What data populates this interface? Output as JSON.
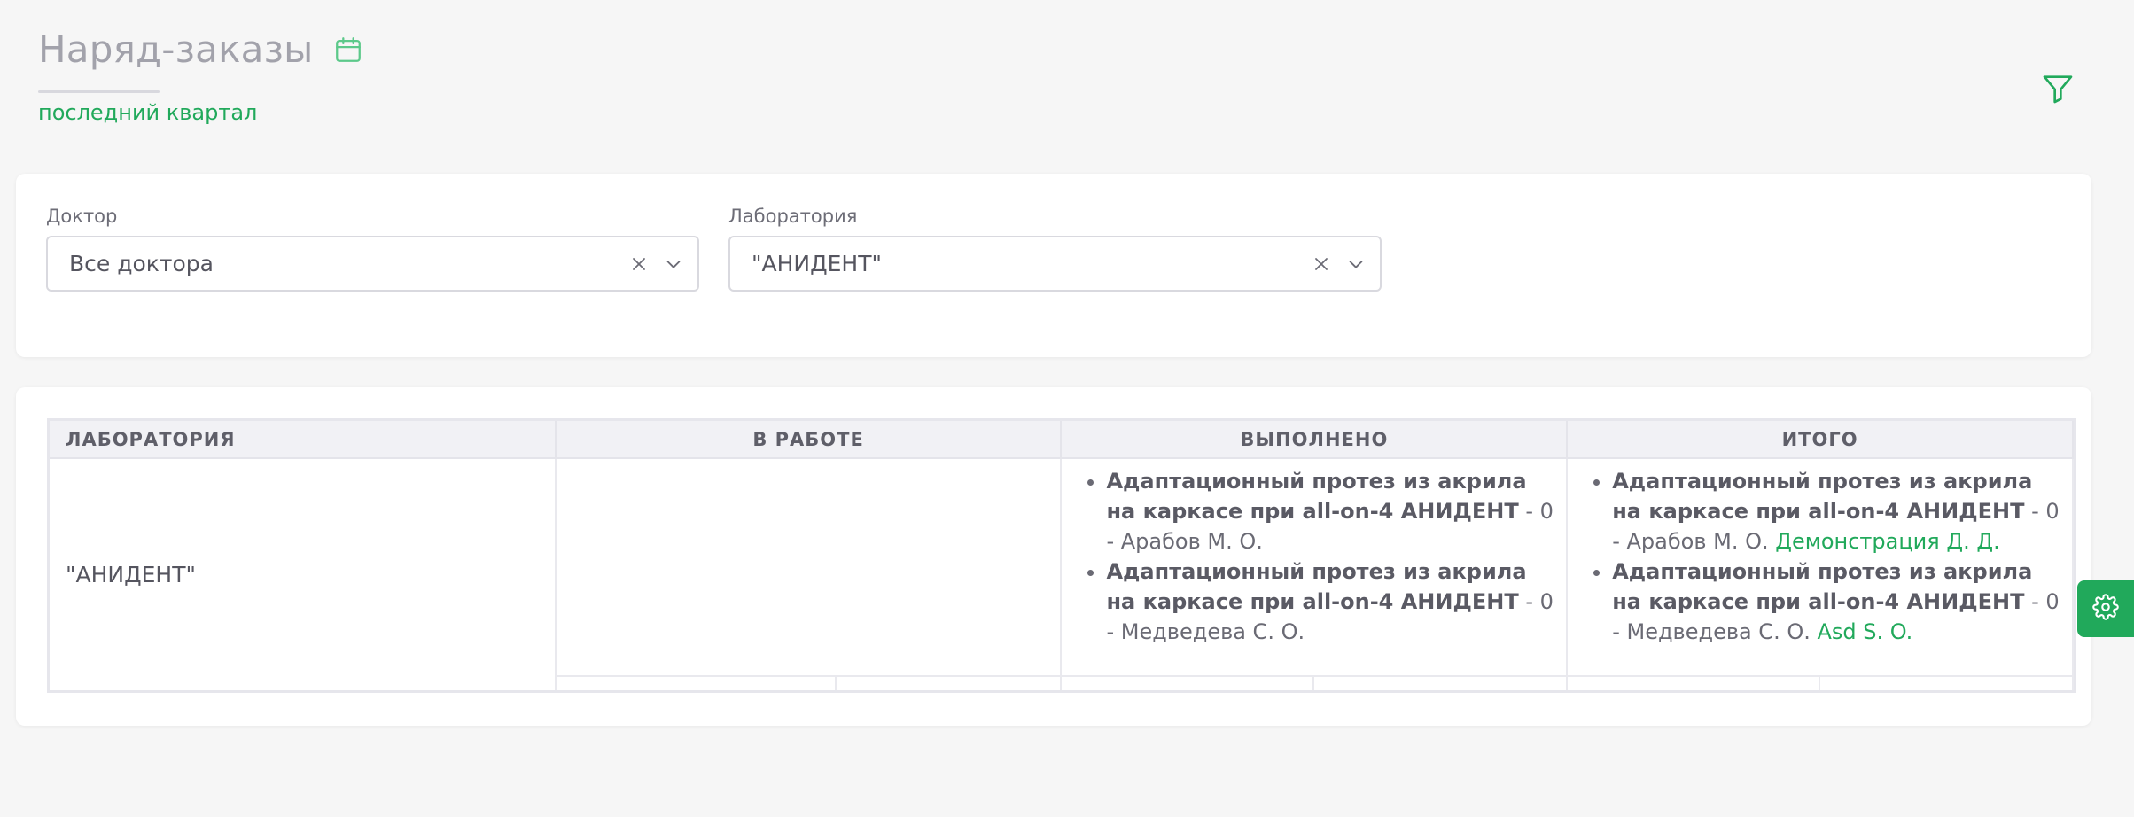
{
  "header": {
    "title": "Наряд-заказы",
    "period": "последний квартал"
  },
  "filters": {
    "doctor": {
      "label": "Доктор",
      "value": "Все доктора"
    },
    "laboratory": {
      "label": "Лаборатория",
      "value": "\"АНИДЕНТ\""
    }
  },
  "table": {
    "columns": [
      "ЛАБОРАТОРИЯ",
      "В РАБОТЕ",
      "ВЫПОЛНЕНО",
      "ИТОГО"
    ],
    "rows": [
      {
        "lab": "\"АНИДЕНТ\"",
        "in_work": [],
        "done": [
          {
            "item": "Адаптационный протез из акрила на каркасе при all-on-4 АНИДЕНТ",
            "rest": " - 0 - Арабов М. О."
          },
          {
            "item": "Адаптационный протез из акрила на каркасе при all-on-4 АНИДЕНТ",
            "rest": " - 0 - Медведева С. О."
          }
        ],
        "total": [
          {
            "item": "Адаптационный протез из акрила на каркасе при all-on-4 АНИДЕНТ",
            "rest": " - 0 - Арабов М. О. ",
            "extra": "Демонстрация Д. Д."
          },
          {
            "item": "Адаптационный протез из акрила на каркасе при all-on-4 АНИДЕНТ",
            "rest": " - 0 - Медведева С. О. ",
            "extra": "Asd S. O."
          }
        ]
      }
    ]
  },
  "icons": {
    "calendar": "calendar-icon",
    "filter": "filter-icon",
    "clear": "close-icon",
    "chevron": "chevron-down-icon",
    "settings": "gear-icon"
  },
  "colors": {
    "accent": "#21a95b",
    "title": "#a2a2ab"
  }
}
